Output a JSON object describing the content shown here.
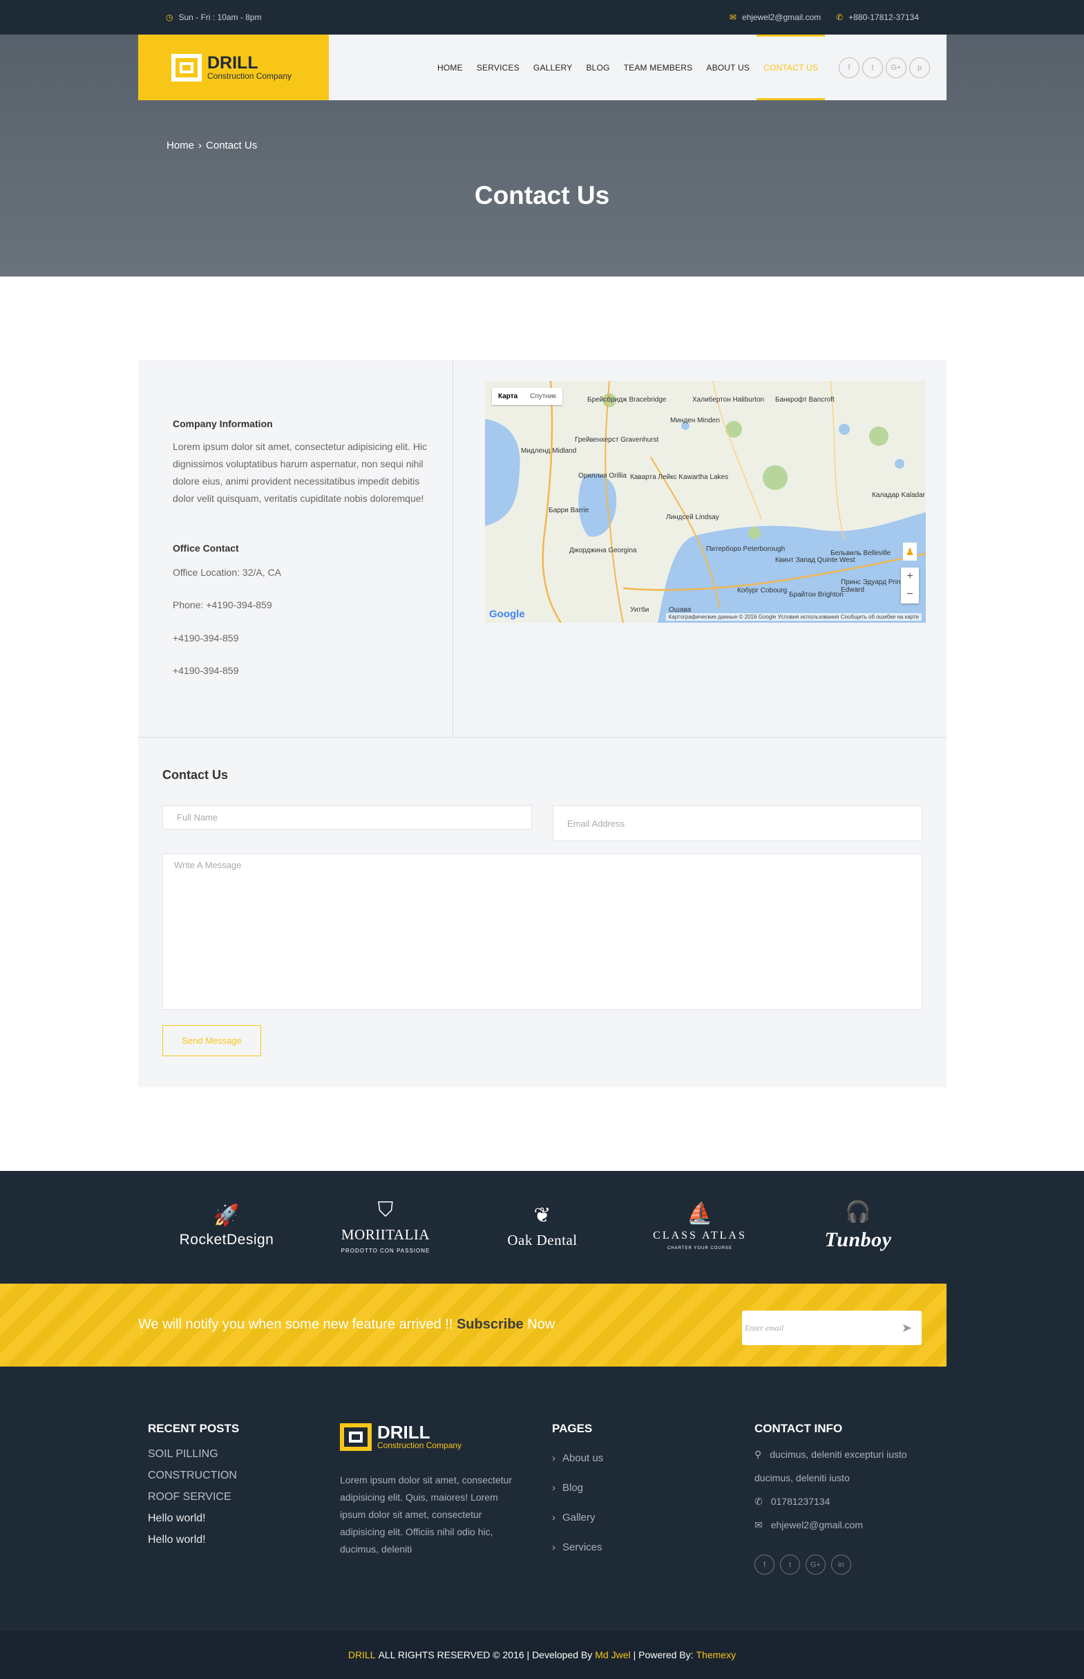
{
  "topbar": {
    "hours": "Sun - Fri : 10am - 8pm",
    "email": "ehjewel2@gmail.com",
    "phone": "+880-17812-37134"
  },
  "brand": {
    "name": "DRILL",
    "tagline": "Construction Company"
  },
  "nav": {
    "items": [
      "HOME",
      "SERVICES",
      "GALLERY",
      "BLOG",
      "TEAM MEMBERS",
      "ABOUT US",
      "CONTACT US"
    ],
    "active": "CONTACT US",
    "socials": [
      "f",
      "t",
      "G+",
      "p"
    ]
  },
  "hero": {
    "breadcrumb_home": "Home",
    "breadcrumb_sep": "›",
    "breadcrumb_current": "Contact Us",
    "title": "Contact Us"
  },
  "company": {
    "heading": "Company Information",
    "body": "Lorem ipsum dolor sit amet, consectetur adipisicing elit. Hic dignissimos voluptatibus harum aspernatur, non sequi nihil dolore eius, animi provident necessitatibus impedit debitis dolor velit quisquam, veritatis cupiditate nobis doloremque!",
    "office_heading": "Office Contact",
    "location": "Office Location: 32/A, CA",
    "phone": "Phone: +4190-394-859",
    "phone2": "+4190-394-859",
    "phone3": "+4190-394-859"
  },
  "map": {
    "tab_map": "Карта",
    "tab_sat": "Спутник",
    "attribution": "Картографические данные © 2016 Google   Условия использования   Сообщить об ошибке на карте",
    "google": "Google",
    "labels": [
      "Брейсбридж Bracebridge",
      "Грейвенхерст Gravenhurst",
      "Мидленд Midland",
      "Ориллия Orillia",
      "Кавартa Лейкс Kawartha Lakes",
      "Барри Barrie",
      "Линдсей Lindsay",
      "Джорджина Georgina",
      "Питерборо Peterborough",
      "Квинт Запад Quinte West",
      "Бельвиль Belleville",
      "Принс Эдуард Prince Edward",
      "Кобург Cobourg",
      "Ошава",
      "Уитби",
      "Халибертон Haliburton",
      "Минден Minden",
      "Банкрофт Bancroft",
      "Калaдар Kaladar",
      "Брайтон Brighton"
    ]
  },
  "form": {
    "heading": "Contact Us",
    "name_placeholder": "Full Name",
    "email_placeholder": "Email Address",
    "message_placeholder": "Write A Message",
    "send_label": "Send Message"
  },
  "brands": [
    {
      "name": "RocketDesign",
      "sub": ""
    },
    {
      "name": "MORIITALIA",
      "sub": "PRODOTTO CON PASSIONE"
    },
    {
      "name": "Oak Dental",
      "sub": ""
    },
    {
      "name": "CLASS ATLAS",
      "sub": "CHARTER YOUR COURSE"
    },
    {
      "name": "Tunboy",
      "sub": ""
    }
  ],
  "subscribe": {
    "text_before": "We will notify you when some new feature arrived !! ",
    "text_bold": "Subscribe",
    "text_after": " Now",
    "placeholder": "Enter email"
  },
  "footer": {
    "recent_heading": "RECENT POSTS",
    "posts": [
      "SOIL PILLING",
      "CONSTRUCTION",
      "ROOF SERVICE",
      "Hello world!",
      "Hello world!"
    ],
    "about": "Lorem ipsum dolor sit amet, consectetur adipisicing elit. Quis, maiores! Lorem ipsum dolor sit amet, consectetur adipisicing elit. Officiis nihil odio hic, ducimus, deleniti",
    "pages_heading": "PAGES",
    "pages": [
      "About us",
      "Blog",
      "Gallery",
      "Services"
    ],
    "contact_heading": "CONTACT INFO",
    "address": "ducimus, deleniti excepturi iusto ducimus, deleniti iusto",
    "address_line1": "ducimus, deleniti excepturi iusto",
    "address_line2": "ducimus, deleniti iusto",
    "phone": "01781237134",
    "email": "ehjewel2@gmail.com",
    "socials": [
      "f",
      "t",
      "G+",
      "in"
    ]
  },
  "copyright": {
    "brand": "DRILL",
    "text1": "ALL RIGHTS RESERVED © 2016 | Developed By",
    "dev": "Md Jwel",
    "text2": "| Powered By:",
    "power": "Themexy"
  },
  "colors": {
    "accent": "#f8c617",
    "dark": "#1f2a37",
    "hero": "#5f6871",
    "panel": "#f4f5f7"
  }
}
